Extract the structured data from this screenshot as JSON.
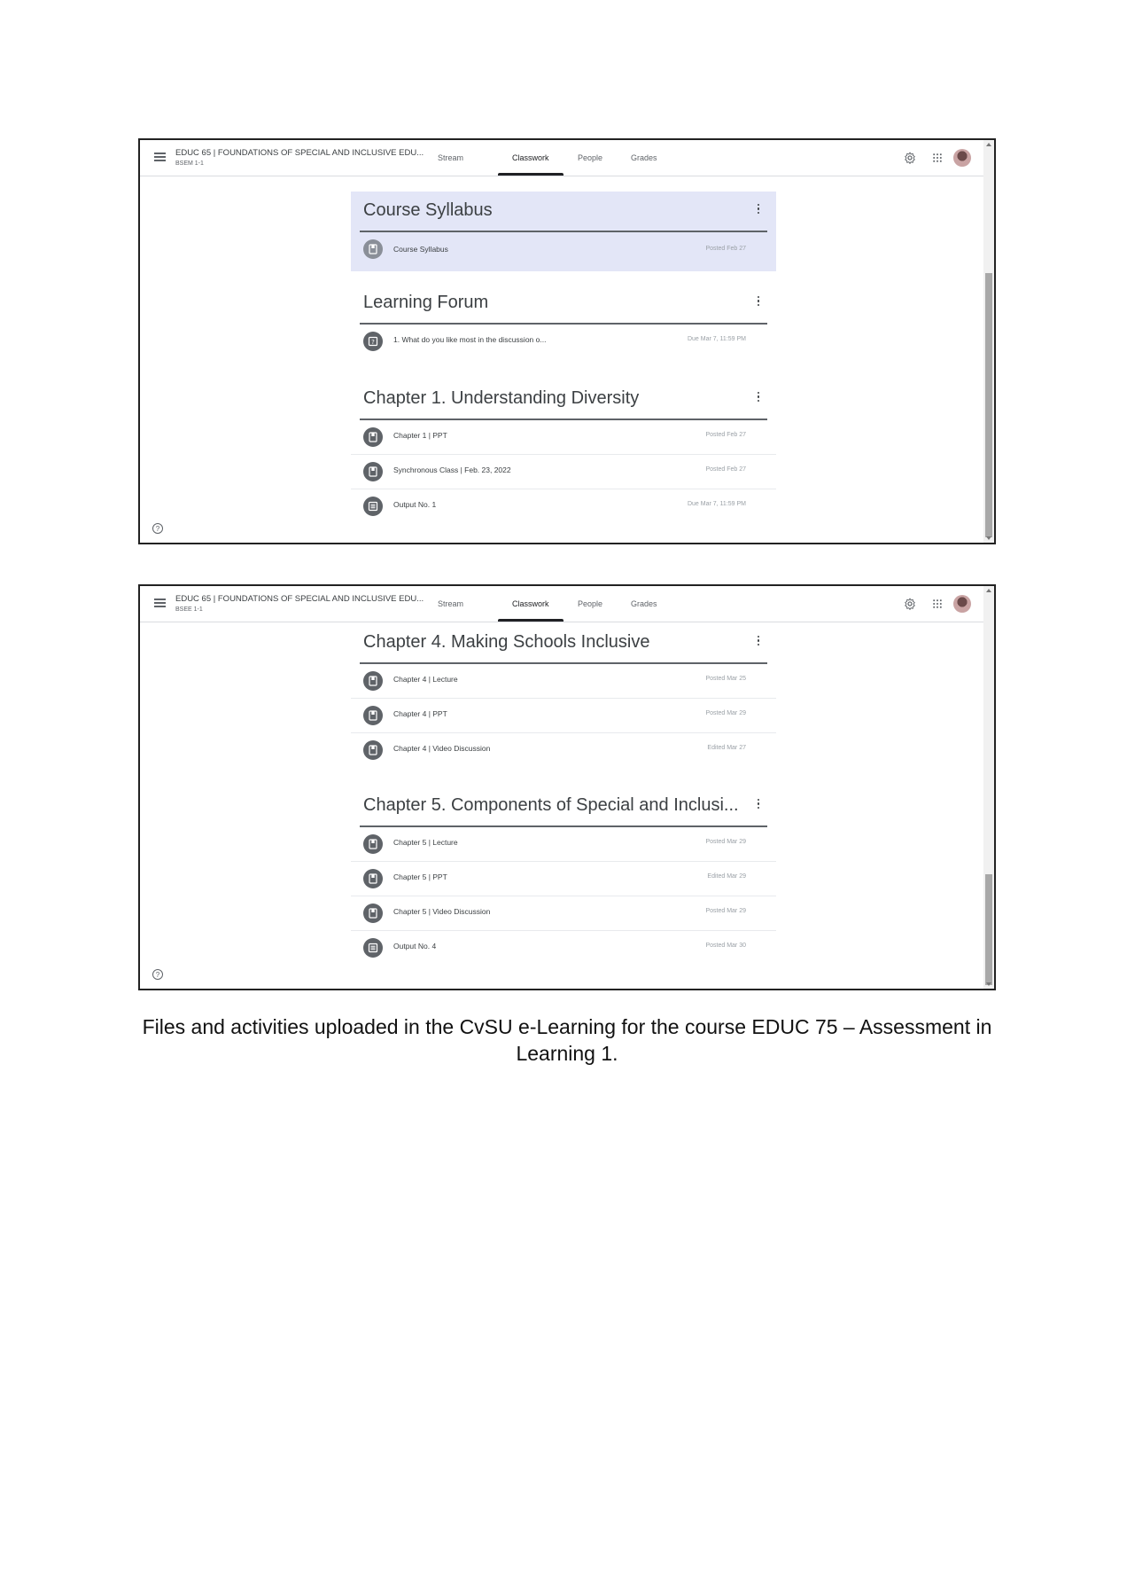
{
  "screens": [
    {
      "header": {
        "course_title": "EDUC 65 | FOUNDATIONS OF SPECIAL AND INCLUSIVE EDU...",
        "course_section": "BSEM 1-1",
        "tabs": [
          "Stream",
          "Classwork",
          "People",
          "Grades"
        ],
        "active_tab": "Classwork"
      },
      "topics": [
        {
          "title": "Course Syllabus",
          "items": [
            {
              "label": "Course Syllabus",
              "meta": "Posted Feb 27",
              "icon": "material-icon"
            }
          ]
        },
        {
          "title": "Learning Forum",
          "items": [
            {
              "label": "1. What do you like most in the discussion o...",
              "meta": "Due Mar 7, 11:59 PM",
              "icon": "question-icon"
            }
          ]
        },
        {
          "title": "Chapter 1. Understanding Diversity",
          "items": [
            {
              "label": "Chapter 1 | PPT",
              "meta": "Posted Feb 27",
              "icon": "material-icon"
            },
            {
              "label": "Synchronous Class | Feb. 23, 2022",
              "meta": "Posted Feb 27",
              "icon": "material-icon"
            },
            {
              "label": "Output No. 1",
              "meta": "Due Mar 7, 11:59 PM",
              "icon": "assignment-icon"
            }
          ]
        }
      ]
    },
    {
      "header": {
        "course_title": "EDUC 65 | FOUNDATIONS OF SPECIAL AND INCLUSIVE EDU...",
        "course_section": "BSEE 1-1",
        "tabs": [
          "Stream",
          "Classwork",
          "People",
          "Grades"
        ],
        "active_tab": "Classwork"
      },
      "topics": [
        {
          "title": "Chapter 4. Making Schools Inclusive",
          "items": [
            {
              "label": "Chapter 4 | Lecture",
              "meta": "Posted Mar 25",
              "icon": "material-icon"
            },
            {
              "label": "Chapter 4 | PPT",
              "meta": "Posted Mar 29",
              "icon": "material-icon"
            },
            {
              "label": "Chapter 4 | Video Discussion",
              "meta": "Edited Mar 27",
              "icon": "material-icon"
            }
          ]
        },
        {
          "title": "Chapter 5. Components of Special and Inclusi...",
          "items": [
            {
              "label": "Chapter 5 | Lecture",
              "meta": "Posted Mar 29",
              "icon": "material-icon"
            },
            {
              "label": "Chapter 5 | PPT",
              "meta": "Edited Mar 29",
              "icon": "material-icon"
            },
            {
              "label": "Chapter 5 | Video Discussion",
              "meta": "Posted Mar 29",
              "icon": "material-icon"
            },
            {
              "label": "Output No. 4",
              "meta": "Posted Mar 30",
              "icon": "assignment-icon"
            }
          ]
        }
      ]
    }
  ],
  "caption": "Files and activities uploaded in the CvSU e-Learning for the course EDUC 75 – Assessment in Learning 1.",
  "colors": {
    "highlight": "#e3e6f7",
    "icon_bg": "#5f6368",
    "text": "#3c4043",
    "meta": "#9aa0a6"
  },
  "help_glyph": "?"
}
